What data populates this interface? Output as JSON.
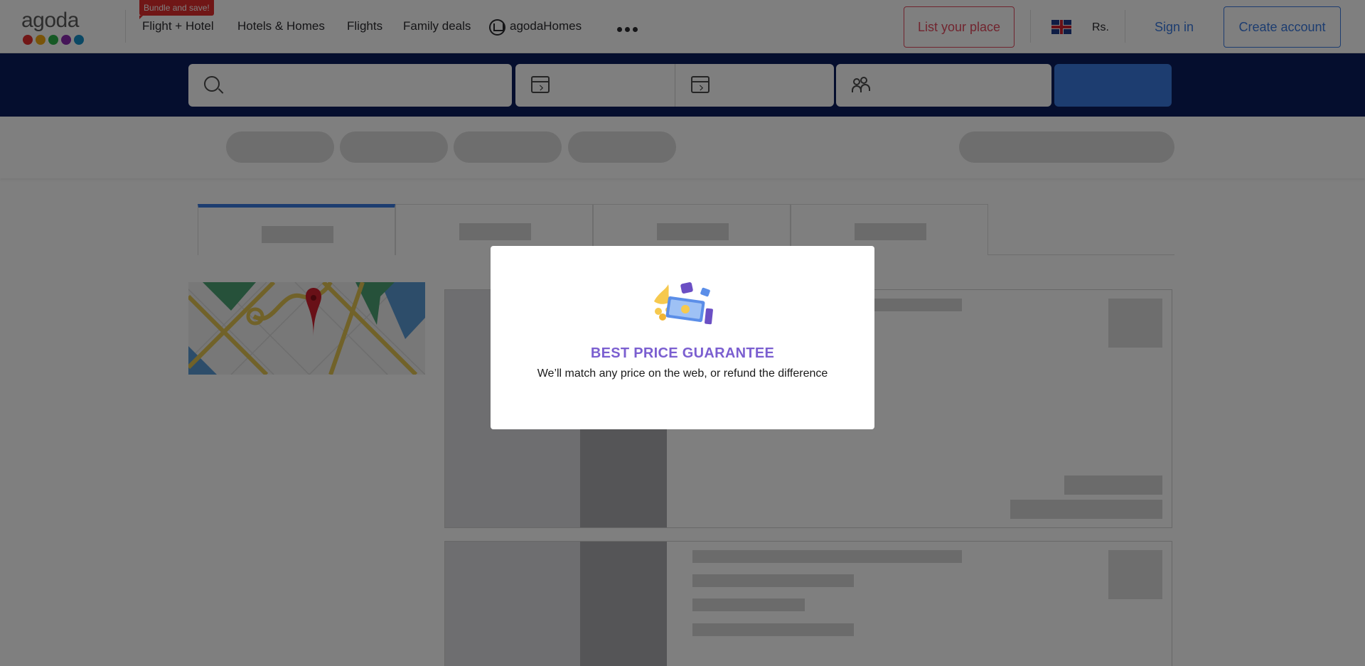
{
  "nav": {
    "bundle_badge": "Bundle and save!",
    "items": [
      {
        "label": "Flight + Hotel"
      },
      {
        "label": "Hotels & Homes"
      },
      {
        "label": "Flights"
      },
      {
        "label": "Family deals"
      },
      {
        "label": "agodaHomes"
      }
    ],
    "list_your_place": "List your place",
    "currency": "Rs.",
    "sign_in": "Sign in",
    "create_account": "Create account",
    "logo_text": "agoda",
    "logo_colors": [
      "#e52e2e",
      "#f2a813",
      "#2cb24a",
      "#8a2ab0",
      "#1591c9"
    ]
  },
  "colors": {
    "accent": "#3b7ae0",
    "search_band": "#0b1c5c",
    "list_place": "#e24a5e",
    "modal_title": "#7b5fd0"
  },
  "modal": {
    "title": "BEST PRICE GUARANTEE",
    "subtitle": "We’ll match any price on the web, or refund the difference"
  }
}
